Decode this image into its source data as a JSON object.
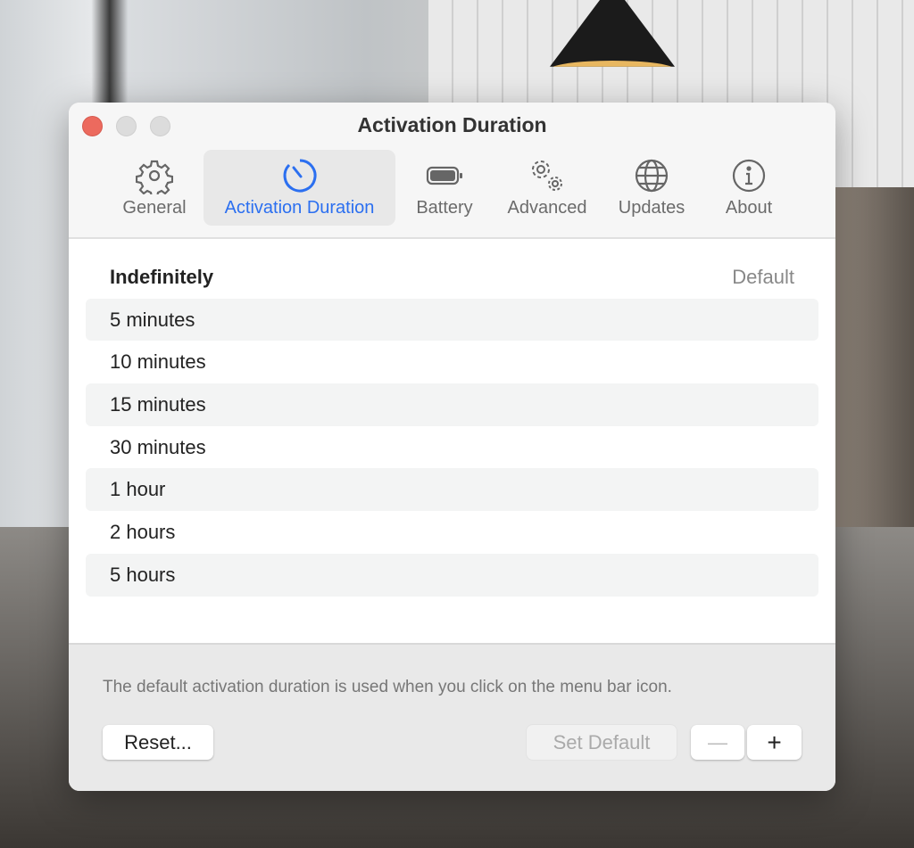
{
  "window": {
    "title": "Activation Duration"
  },
  "tabs": [
    {
      "label": "General",
      "icon": "gear-icon"
    },
    {
      "label": "Activation Duration",
      "icon": "timer-icon",
      "active": true
    },
    {
      "label": "Battery",
      "icon": "battery-icon"
    },
    {
      "label": "Advanced",
      "icon": "gears-icon"
    },
    {
      "label": "Updates",
      "icon": "globe-icon"
    },
    {
      "label": "About",
      "icon": "info-icon"
    }
  ],
  "durations": {
    "default_item": "Indefinitely",
    "default_label": "Default",
    "items": [
      "5 minutes",
      "10 minutes",
      "15 minutes",
      "30 minutes",
      "1 hour",
      "2 hours",
      "5 hours"
    ]
  },
  "footer": {
    "hint": "The default activation duration is used when you click on the menu bar icon.",
    "reset": "Reset...",
    "set_default": "Set Default",
    "remove": "—",
    "add": "+"
  },
  "colors": {
    "accent": "#2b6ff0",
    "close": "#ec6a5e"
  }
}
